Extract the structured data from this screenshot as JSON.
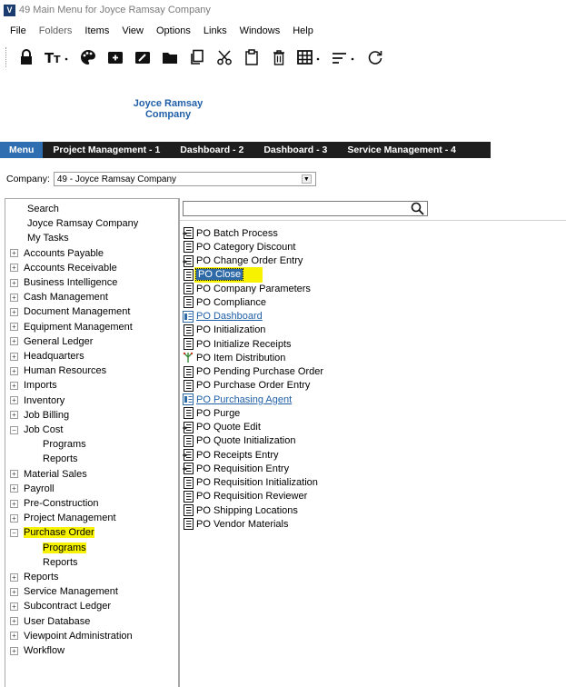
{
  "window": {
    "title": "49 Main Menu for Joyce Ramsay Company"
  },
  "menubar": [
    {
      "label": "File",
      "dim": false
    },
    {
      "label": "Folders",
      "dim": true
    },
    {
      "label": "Items",
      "dim": false
    },
    {
      "label": "View",
      "dim": false
    },
    {
      "label": "Options",
      "dim": false
    },
    {
      "label": "Links",
      "dim": false
    },
    {
      "label": "Windows",
      "dim": false
    },
    {
      "label": "Help",
      "dim": false
    }
  ],
  "toolbar": {
    "icons": [
      "lock-icon",
      "text-size-icon",
      "palette-icon",
      "new-folder-icon",
      "edit-icon",
      "folder-icon",
      "copy-icon",
      "cut-icon",
      "paste-icon",
      "delete-icon",
      "grid-icon",
      "sort-icon",
      "refresh-icon"
    ]
  },
  "logo": {
    "line1": "Joyce Ramsay",
    "line2": "Company"
  },
  "tabs": [
    {
      "label": "Menu",
      "active": true
    },
    {
      "label": "Project Management - 1",
      "active": false
    },
    {
      "label": "Dashboard - 2",
      "active": false
    },
    {
      "label": "Dashboard - 3",
      "active": false
    },
    {
      "label": "Service Management - 4",
      "active": false
    }
  ],
  "company": {
    "label": "Company:",
    "value": "49 - Joyce Ramsay Company"
  },
  "tree": [
    {
      "label": "Search",
      "indent": 1,
      "exp": ""
    },
    {
      "label": "Joyce Ramsay Company",
      "indent": 1,
      "exp": ""
    },
    {
      "label": "My Tasks",
      "indent": 1,
      "exp": ""
    },
    {
      "label": "Accounts Payable",
      "indent": 0,
      "exp": "+"
    },
    {
      "label": "Accounts Receivable",
      "indent": 0,
      "exp": "+"
    },
    {
      "label": "Business Intelligence",
      "indent": 0,
      "exp": "+"
    },
    {
      "label": "Cash Management",
      "indent": 0,
      "exp": "+"
    },
    {
      "label": "Document Management",
      "indent": 0,
      "exp": "+"
    },
    {
      "label": "Equipment Management",
      "indent": 0,
      "exp": "+"
    },
    {
      "label": "General Ledger",
      "indent": 0,
      "exp": "+"
    },
    {
      "label": "Headquarters",
      "indent": 0,
      "exp": "+"
    },
    {
      "label": "Human Resources",
      "indent": 0,
      "exp": "+"
    },
    {
      "label": "Imports",
      "indent": 0,
      "exp": "+"
    },
    {
      "label": "Inventory",
      "indent": 0,
      "exp": "+"
    },
    {
      "label": "Job Billing",
      "indent": 0,
      "exp": "+"
    },
    {
      "label": "Job Cost",
      "indent": 0,
      "exp": "-"
    },
    {
      "label": "Programs",
      "indent": 2,
      "exp": ""
    },
    {
      "label": "Reports",
      "indent": 2,
      "exp": ""
    },
    {
      "label": "Material Sales",
      "indent": 0,
      "exp": "+"
    },
    {
      "label": "Payroll",
      "indent": 0,
      "exp": "+"
    },
    {
      "label": "Pre-Construction",
      "indent": 0,
      "exp": "+"
    },
    {
      "label": "Project Management",
      "indent": 0,
      "exp": "+"
    },
    {
      "label": "Purchase Order",
      "indent": 0,
      "exp": "-",
      "highlight": true
    },
    {
      "label": "Programs",
      "indent": 2,
      "exp": "",
      "highlight": true
    },
    {
      "label": "Reports",
      "indent": 2,
      "exp": ""
    },
    {
      "label": "Reports",
      "indent": 0,
      "exp": "+"
    },
    {
      "label": "Service Management",
      "indent": 0,
      "exp": "+"
    },
    {
      "label": "Subcontract Ledger",
      "indent": 0,
      "exp": "+"
    },
    {
      "label": "User Database",
      "indent": 0,
      "exp": "+"
    },
    {
      "label": "Viewpoint Administration",
      "indent": 0,
      "exp": "+"
    },
    {
      "label": "Workflow",
      "indent": 0,
      "exp": "+"
    }
  ],
  "search": {
    "value": ""
  },
  "forms": [
    {
      "label": "PO Batch Process",
      "icon": "process-form-icon"
    },
    {
      "label": "PO Category Discount",
      "icon": "form-icon"
    },
    {
      "label": "PO Change Order Entry",
      "icon": "process-form-icon"
    },
    {
      "label": "PO Close",
      "icon": "form-icon",
      "selected": true
    },
    {
      "label": "PO Company Parameters",
      "icon": "form-icon"
    },
    {
      "label": "PO Compliance",
      "icon": "form-icon"
    },
    {
      "label": "PO Dashboard",
      "icon": "dashboard-icon",
      "link": true
    },
    {
      "label": "PO Initialization",
      "icon": "form-icon"
    },
    {
      "label": "PO Initialize Receipts",
      "icon": "form-icon"
    },
    {
      "label": "PO Item Distribution",
      "icon": "distribution-icon"
    },
    {
      "label": "PO Pending Purchase Order",
      "icon": "form-icon"
    },
    {
      "label": "PO Purchase Order Entry",
      "icon": "form-icon"
    },
    {
      "label": "PO Purchasing Agent",
      "icon": "dashboard-icon",
      "link": true
    },
    {
      "label": "PO Purge",
      "icon": "form-icon"
    },
    {
      "label": "PO Quote Edit",
      "icon": "process-form-icon"
    },
    {
      "label": "PO Quote Initialization",
      "icon": "form-icon"
    },
    {
      "label": "PO Receipts Entry",
      "icon": "process-form-icon"
    },
    {
      "label": "PO Requisition Entry",
      "icon": "process-form-icon"
    },
    {
      "label": "PO Requisition Initialization",
      "icon": "form-icon"
    },
    {
      "label": "PO Requisition Reviewer",
      "icon": "form-icon"
    },
    {
      "label": "PO Shipping Locations",
      "icon": "form-icon"
    },
    {
      "label": "PO Vendor Materials",
      "icon": "form-icon"
    }
  ],
  "colors": {
    "accent": "#2f6fb1",
    "highlight": "#f6f200",
    "link": "#1f5fa8",
    "tabbar": "#1e1e1e"
  }
}
